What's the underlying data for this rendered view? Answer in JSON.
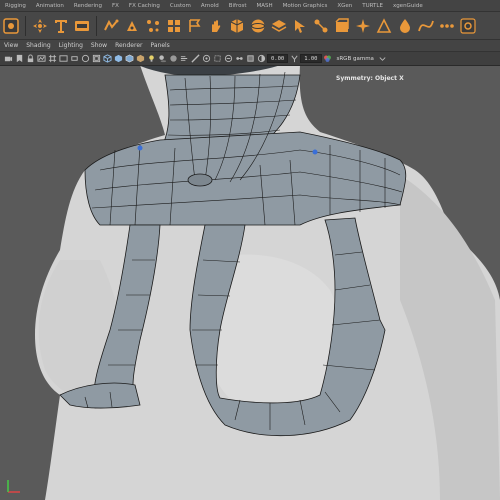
{
  "shelf_tabs": [
    "Rigging",
    "Animation",
    "Rendering",
    "FX",
    "FX Caching",
    "Custom",
    "Arnold",
    "Bifrost",
    "MASH",
    "Motion Graphics",
    "XGen",
    "TURTLE",
    "xgenGuide"
  ],
  "viewport_menu": [
    "View",
    "Shading",
    "Lighting",
    "Show",
    "Renderer",
    "Panels"
  ],
  "toolbar": {
    "exposure_value": "0.00",
    "gamma_value": "1.00",
    "color_space": "sRGB gamma"
  },
  "viewport": {
    "symmetry_label": "Symmetry: Object X",
    "background_color": "#5a5a5a",
    "mesh_color": "#8f9aa3",
    "body_color": "#d6d6d6"
  },
  "icons": [
    "snap-icon",
    "move-tool-icon",
    "text-tool-icon",
    "svg-icon",
    "fx-icon",
    "paint-icon",
    "settings-icon"
  ],
  "colors": {
    "accent": "#e9983a",
    "toolbar_bg": "#444444"
  }
}
